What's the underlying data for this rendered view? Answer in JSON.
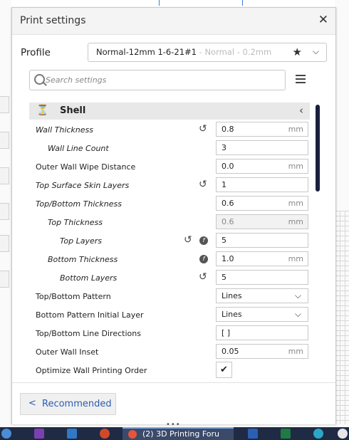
{
  "window": {
    "title": "Print settings"
  },
  "profile": {
    "label": "Profile",
    "name": "Normal-12mm 1-6-21#1",
    "suffix": " - Normal - 0.2mm"
  },
  "search": {
    "placeholder": "Search settings"
  },
  "category": {
    "label": "Shell"
  },
  "settings": [
    {
      "label": "Wall Thickness",
      "value": "0.8",
      "unit": "mm"
    },
    {
      "label": "Wall Line Count",
      "value": "3",
      "unit": ""
    },
    {
      "label": "Outer Wall Wipe Distance",
      "value": "0.0",
      "unit": "mm"
    },
    {
      "label": "Top Surface Skin Layers",
      "value": "1",
      "unit": ""
    },
    {
      "label": "Top/Bottom Thickness",
      "value": "0.6",
      "unit": "mm"
    },
    {
      "label": "Top Thickness",
      "value": "0.6",
      "unit": "mm"
    },
    {
      "label": "Top Layers",
      "value": "5",
      "unit": ""
    },
    {
      "label": "Bottom Thickness",
      "value": "1.0",
      "unit": "mm"
    },
    {
      "label": "Bottom Layers",
      "value": "5",
      "unit": ""
    },
    {
      "label": "Top/Bottom Pattern",
      "value": "Lines"
    },
    {
      "label": "Bottom Pattern Initial Layer",
      "value": "Lines"
    },
    {
      "label": "Top/Bottom Line Directions",
      "value": "[ ]"
    },
    {
      "label": "Outer Wall Inset",
      "value": "0.05",
      "unit": "mm"
    },
    {
      "label": "Optimize Wall Printing Order",
      "checked": true
    }
  ],
  "footer": {
    "recommended_label": "Recommended"
  },
  "taskbar": {
    "active_task": "(2) 3D Printing Foru"
  },
  "colors": {
    "accent": "#2a5db0",
    "scrollbar": "#1a1f3d",
    "category_bg": "#e8e8e8"
  }
}
